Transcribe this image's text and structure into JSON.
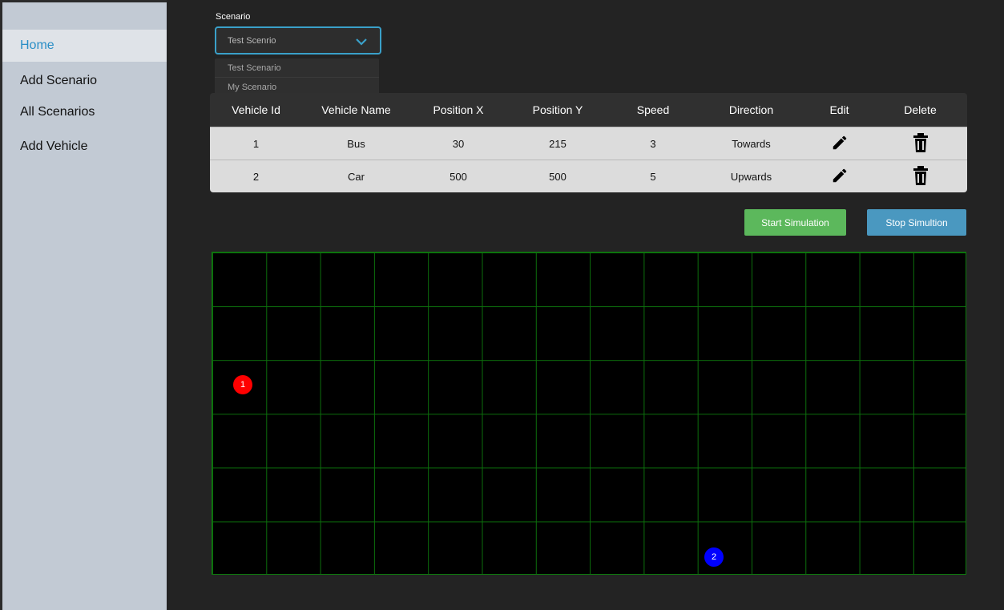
{
  "sidebar": {
    "items": [
      {
        "label": "Home"
      },
      {
        "label": "Add Scenario"
      },
      {
        "label": "All Scenarios"
      },
      {
        "label": "Add Vehicle"
      }
    ]
  },
  "scenario": {
    "label": "Scenario",
    "selected": "Test Scenrio",
    "options": [
      "Test Scenario",
      "My Scenario"
    ]
  },
  "table": {
    "headers": [
      "Vehicle Id",
      "Vehicle Name",
      "Position X",
      "Position Y",
      "Speed",
      "Direction",
      "Edit",
      "Delete"
    ],
    "rows": [
      {
        "id": "1",
        "name": "Bus",
        "x": "30",
        "y": "215",
        "speed": "3",
        "direction": "Towards"
      },
      {
        "id": "2",
        "name": "Car",
        "x": "500",
        "y": "500",
        "speed": "5",
        "direction": "Upwards"
      }
    ]
  },
  "buttons": {
    "start": "Start Simulation",
    "stop": "Stop Simultion"
  },
  "simulation": {
    "vehicles": [
      {
        "id": "1",
        "color": "#ff0000"
      },
      {
        "id": "2",
        "color": "#0000ff"
      }
    ]
  },
  "colors": {
    "accent": "#2a8ec6",
    "start_button": "#5cb85c",
    "stop_button": "#4a98c0",
    "grid_line": "#0c6f0c"
  }
}
